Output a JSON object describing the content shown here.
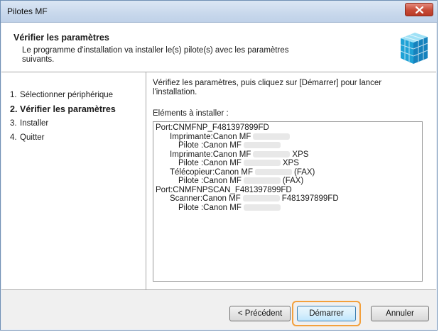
{
  "window": {
    "title": "Pilotes MF",
    "close_icon": "close-icon"
  },
  "header": {
    "title": "Vérifier les paramètres",
    "description": "Le programme d'installation va installer le(s) pilote(s) avec les paramètres suivants.",
    "logo_icon": "canon-cube-logo"
  },
  "steps": [
    {
      "num": "1.",
      "label": "Sélectionner périphérique",
      "active": false
    },
    {
      "num": "2.",
      "label": "Vérifier les paramètres",
      "active": true
    },
    {
      "num": "3.",
      "label": "Installer",
      "active": false
    },
    {
      "num": "4.",
      "label": "Quitter",
      "active": false
    }
  ],
  "content": {
    "instruction": "Vérifiez les paramètres, puis cliquez sur [Démarrer] pour lancer l'installation.",
    "list_label": "Eléments à installer :",
    "items": [
      {
        "indent": 0,
        "text": "Port:CNMFNP_F481397899FD",
        "suffix": ""
      },
      {
        "indent": 1,
        "text": "Imprimante:Canon MF",
        "suffix": ""
      },
      {
        "indent": 2,
        "text": "Pilote :Canon MF",
        "suffix": ""
      },
      {
        "indent": 1,
        "text": "Imprimante:Canon MF",
        "suffix": "XPS"
      },
      {
        "indent": 2,
        "text": "Pilote :Canon MF",
        "suffix": "XPS"
      },
      {
        "indent": 1,
        "text": "Télécopieur:Canon MF",
        "suffix": "(FAX)"
      },
      {
        "indent": 2,
        "text": "Pilote :Canon MF",
        "suffix": "(FAX)"
      },
      {
        "indent": 0,
        "text": "Port:CNMFNPSCAN_F481397899FD",
        "suffix": ""
      },
      {
        "indent": 1,
        "text": "Scanner:Canon MF",
        "suffix": "F481397899FD"
      },
      {
        "indent": 2,
        "text": "Pilote :Canon MF",
        "suffix": ""
      }
    ]
  },
  "footer": {
    "prev_label": "< Précédent",
    "start_label": "Démarrer",
    "cancel_label": "Annuler",
    "highlight_color": "#f3a03c"
  }
}
